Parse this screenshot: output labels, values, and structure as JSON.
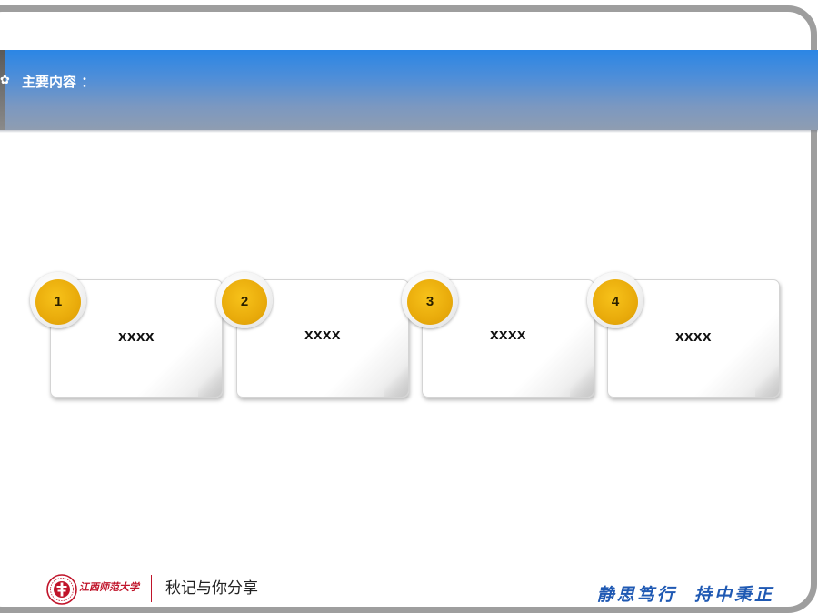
{
  "header": {
    "icon": "flower-bullet-icon",
    "title": "主要内容 ："
  },
  "steps": [
    {
      "number": "1",
      "label": "xxxx"
    },
    {
      "number": "2",
      "label": "xxxx"
    },
    {
      "number": "3",
      "label": "xxxx"
    },
    {
      "number": "4",
      "label": "xxxx"
    }
  ],
  "footer": {
    "logo": "university-seal-logo",
    "university_name": "江西师范大学",
    "text": "秋记与你分享",
    "motto": "静思笃行  持中秉正"
  },
  "colors": {
    "title_band_top": "#2b86e5",
    "title_band_bottom": "#8f9db1",
    "badge": "#e9ab0b",
    "frame": "#9e9e9e",
    "brand_red": "#c0142a",
    "motto_blue": "#1f59b3"
  }
}
